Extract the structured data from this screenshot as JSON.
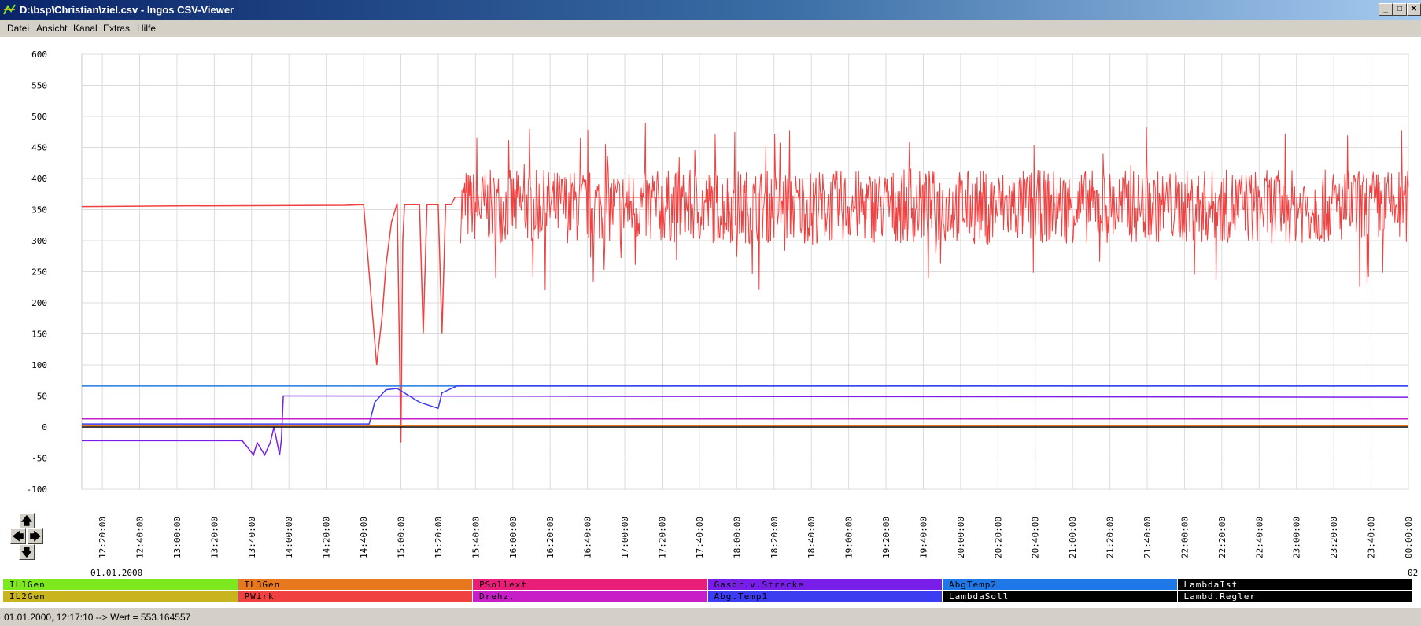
{
  "window": {
    "title": "D:\\bsp\\Christian\\ziel.csv - Ingos CSV-Viewer",
    "min_label": "_",
    "max_label": "□",
    "close_label": "✕"
  },
  "menu": [
    "Datei",
    "Ansicht",
    "Kanal",
    "Extras",
    "Hilfe"
  ],
  "nav": {
    "up": "🡅",
    "left": "🡄",
    "right": "🡆",
    "down": "🡇"
  },
  "x_date": "01.01.2000",
  "x_date_right": "02",
  "legend": [
    {
      "label": "IL1Gen",
      "color": "#7ee81e",
      "text_color": "#000000"
    },
    {
      "label": "IL3Gen",
      "color": "#e8781e",
      "text_color": "#000000"
    },
    {
      "label": "PSollext",
      "color": "#e81e78",
      "text_color": "#000000"
    },
    {
      "label": "Gasdr.v.Strecke",
      "color": "#781ee8",
      "text_color": "#000000"
    },
    {
      "label": "AbgTemp2",
      "color": "#1e78e8",
      "text_color": "#000000"
    },
    {
      "label": "LambdaIst",
      "color": "#000000",
      "text_color": "#ffffff"
    },
    {
      "label": "IL2Gen",
      "color": "#c8b41e",
      "text_color": "#000000"
    },
    {
      "label": "PWirk",
      "color": "#f04040",
      "text_color": "#000000"
    },
    {
      "label": "Drehz.",
      "color": "#c81ec8",
      "text_color": "#000000"
    },
    {
      "label": "Abg.Temp1",
      "color": "#3c3cf0",
      "text_color": "#000000"
    },
    {
      "label": "LambdaSoll",
      "color": "#000000",
      "text_color": "#ffffff"
    },
    {
      "label": "Lambd.Regler",
      "color": "#000000",
      "text_color": "#ffffff"
    }
  ],
  "status": "01.01.2000, 12:17:10 --> Wert = 553.164557",
  "chart_data": {
    "type": "line",
    "grid": true,
    "ylim": [
      -100,
      600
    ],
    "yticks": [
      600,
      550,
      500,
      450,
      400,
      350,
      300,
      250,
      200,
      150,
      100,
      50,
      0,
      -50,
      -100
    ],
    "xlim": [
      "12:09:00",
      "24:00:00"
    ],
    "xticks": [
      "12:20:00",
      "12:40:00",
      "13:00:00",
      "13:20:00",
      "13:40:00",
      "14:00:00",
      "14:20:00",
      "14:40:00",
      "15:00:00",
      "15:20:00",
      "15:40:00",
      "16:00:00",
      "16:20:00",
      "16:40:00",
      "17:00:00",
      "17:20:00",
      "17:40:00",
      "18:00:00",
      "18:20:00",
      "18:40:00",
      "19:00:00",
      "19:20:00",
      "19:40:00",
      "20:00:00",
      "20:20:00",
      "20:40:00",
      "21:00:00",
      "21:20:00",
      "21:40:00",
      "22:00:00",
      "22:20:00",
      "22:40:00",
      "23:00:00",
      "23:20:00",
      "23:40:00",
      "00:00:00"
    ],
    "series": [
      {
        "name": "PWirk",
        "color": "#f04040",
        "x": [
          "12:09",
          "13:00",
          "14:30",
          "14:40",
          "14:47",
          "14:50",
          "14:52",
          "14:55",
          "14:58",
          "15:00",
          "15:01",
          "15:02",
          "15:05",
          "15:10",
          "15:12",
          "15:14",
          "15:20",
          "15:22",
          "15:24",
          "15:27",
          "15:29",
          "15:32",
          "24:00"
        ],
        "y": [
          355,
          356,
          357,
          358,
          100,
          180,
          260,
          330,
          360,
          -25,
          300,
          358,
          358,
          358,
          150,
          358,
          358,
          150,
          358,
          358,
          370,
          370,
          370
        ],
        "noise_from": "15:32",
        "noise_range": [
          270,
          440
        ]
      },
      {
        "name": "AbgTemp2",
        "color": "#1e78e8",
        "x": [
          "12:09",
          "15:00",
          "15:30",
          "24:00"
        ],
        "y": [
          66,
          66,
          66,
          66
        ]
      },
      {
        "name": "Abg.Temp1",
        "color": "#3c3cf0",
        "x": [
          "12:09",
          "14:43",
          "14:46",
          "14:52",
          "14:58",
          "15:10",
          "15:20",
          "15:22",
          "15:30",
          "24:00"
        ],
        "y": [
          5,
          5,
          40,
          60,
          62,
          40,
          30,
          55,
          66,
          66
        ]
      },
      {
        "name": "Gasdr.v.Strecke",
        "color": "#781ee8",
        "x": [
          "12:09",
          "13:35",
          "13:41",
          "13:43",
          "13:47",
          "13:50",
          "13:52",
          "13:55",
          "13:56",
          "13:57",
          "24:00"
        ],
        "y": [
          -22,
          -22,
          -45,
          -25,
          -45,
          -25,
          0,
          -45,
          -20,
          50,
          48
        ]
      },
      {
        "name": "Drehz.",
        "color": "#c81ec8",
        "x": [
          "12:09",
          "24:00"
        ],
        "y": [
          13,
          13
        ]
      },
      {
        "name": "LambdaIst",
        "color": "#000000",
        "x": [
          "12:09",
          "24:00"
        ],
        "y": [
          0,
          0
        ]
      },
      {
        "name": "IL3Gen",
        "color": "#e8781e",
        "x": [
          "12:09",
          "24:00"
        ],
        "y": [
          2,
          2
        ]
      }
    ]
  }
}
